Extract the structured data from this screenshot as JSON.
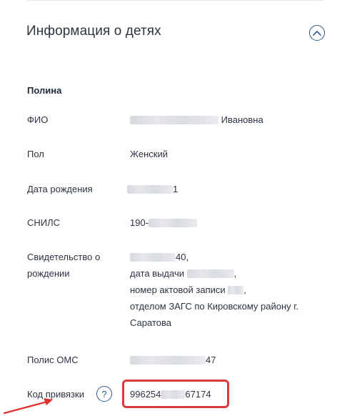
{
  "section": {
    "title": "Информация о детях"
  },
  "child": {
    "name": "Полина",
    "fields": {
      "fio_label": "ФИО",
      "fio_value": "Ивановна",
      "gender_label": "Пол",
      "gender_value": "Женский",
      "birthdate_label": "Дата рождения",
      "birthdate_value": "1",
      "snils_label": "СНИЛС",
      "snils_value": "190-",
      "certificate_label_1": "Свидетельство о",
      "certificate_label_2": "рождении",
      "certificate_number": "40,",
      "certificate_issue_label": "дата выдачи",
      "certificate_issue_suffix": ",",
      "certificate_record_label": "номер актовой записи",
      "certificate_record_suffix": ",",
      "certificate_office_1": "отделом ЗАГС по Кировскому району г.",
      "certificate_office_2": "Саратова",
      "oms_label": "Полис ОМС",
      "oms_value": "47",
      "code_label": "Код привязки",
      "code_prefix": "996254",
      "code_suffix": "67174"
    }
  },
  "icons": {
    "collapse": "chevron-up-icon",
    "help": "question-icon",
    "help_glyph": "?"
  },
  "colors": {
    "accent": "#2f5d8a",
    "highlight": "#d63a3a",
    "arrow": "#e0312f"
  }
}
